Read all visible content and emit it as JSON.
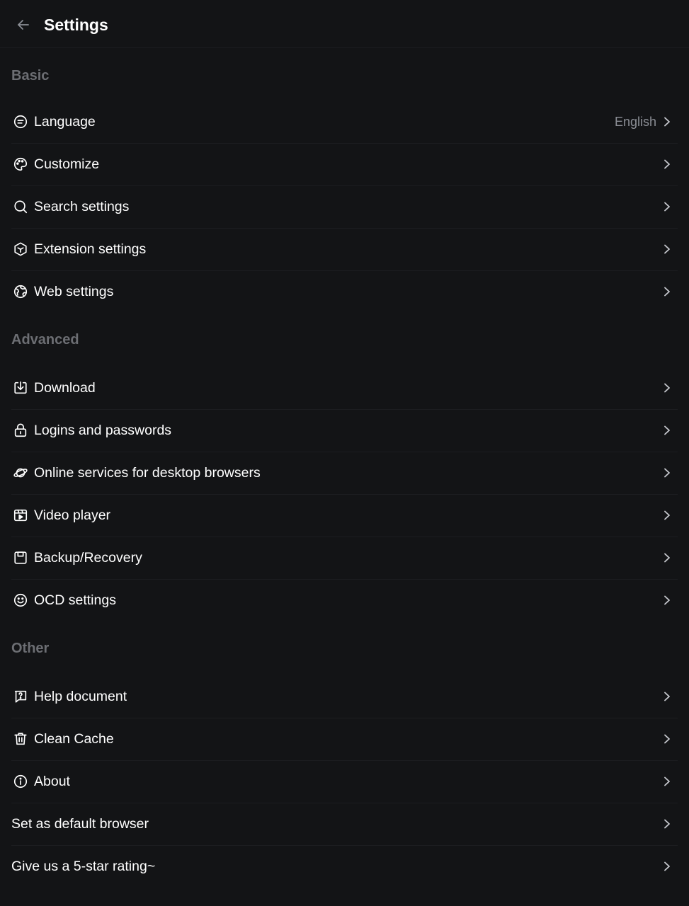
{
  "header": {
    "title": "Settings",
    "back_icon": "arrow-left-icon"
  },
  "sections": {
    "basic": {
      "title": "Basic",
      "items": [
        {
          "label": "Language",
          "value": "English",
          "icon": "language-icon"
        },
        {
          "label": "Customize",
          "icon": "palette-icon"
        },
        {
          "label": "Search settings",
          "icon": "search-icon"
        },
        {
          "label": "Extension settings",
          "icon": "cube-icon"
        },
        {
          "label": "Web settings",
          "icon": "globe-icon"
        }
      ]
    },
    "advanced": {
      "title": "Advanced",
      "items": [
        {
          "label": "Download",
          "icon": "download-icon"
        },
        {
          "label": "Logins and passwords",
          "icon": "lock-icon"
        },
        {
          "label": "Online services for desktop browsers",
          "icon": "planet-icon"
        },
        {
          "label": "Video player",
          "icon": "video-icon"
        },
        {
          "label": "Backup/Recovery",
          "icon": "save-icon"
        },
        {
          "label": "OCD settings",
          "icon": "smiley-icon"
        }
      ]
    },
    "other": {
      "title": "Other",
      "items": [
        {
          "label": "Help document",
          "icon": "help-icon"
        },
        {
          "label": "Clean Cache",
          "icon": "trash-icon"
        },
        {
          "label": "About",
          "icon": "info-icon"
        },
        {
          "label": "Set as default browser"
        },
        {
          "label": "Give us a 5-star rating~"
        }
      ]
    }
  },
  "colors": {
    "background": "#131416",
    "section_title": "#6c6e73",
    "value_text": "#8b8e95",
    "divider": "#1c1d20"
  }
}
